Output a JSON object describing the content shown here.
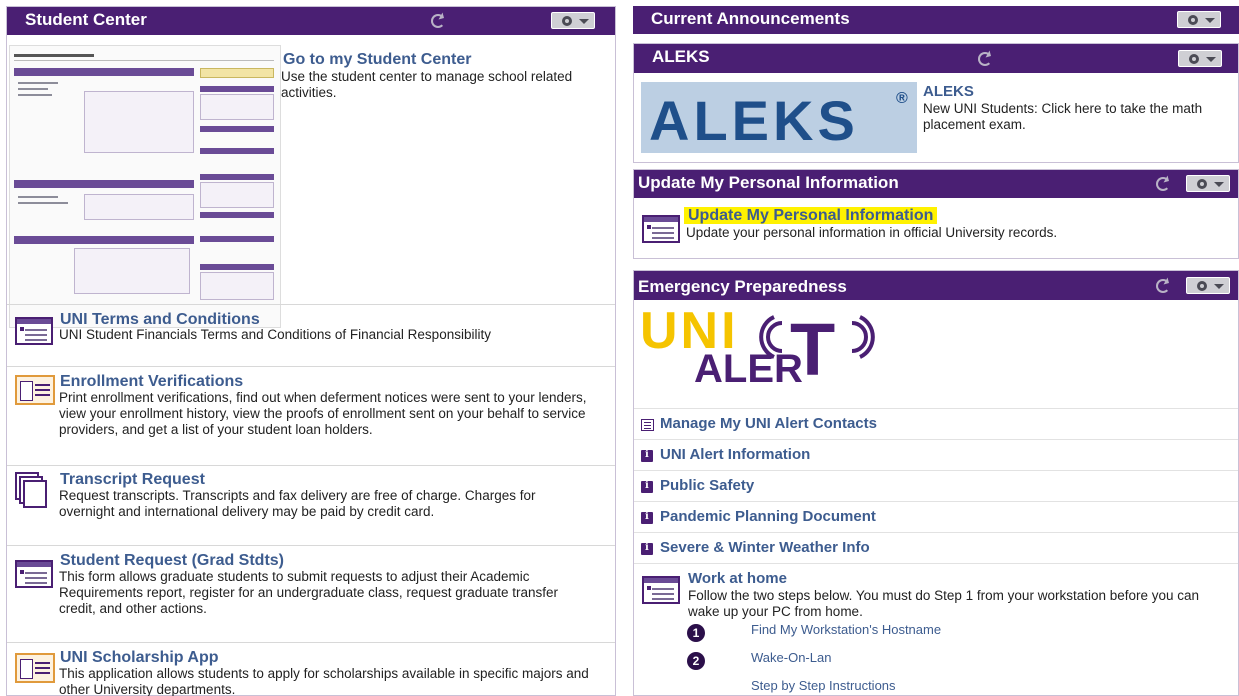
{
  "student_center": {
    "title": "Student Center",
    "go": {
      "title": "Go to my Student Center",
      "desc": "Use the student center to manage school related activities."
    },
    "items": [
      {
        "title": "UNI Terms and Conditions",
        "desc": "UNI Student Financials Terms and Conditions of Financial Responsibility"
      },
      {
        "title": "Enrollment Verifications",
        "desc": "Print enrollment verifications, find out when deferment notices were sent to your lenders, view your enrollment history, view the proofs of enrollment sent on your behalf to service providers, and get a list of your student loan holders."
      },
      {
        "title": "Transcript Request",
        "desc": "Request transcripts. Transcripts and fax delivery are free of charge. Charges for overnight and international delivery may be paid by credit card."
      },
      {
        "title": "Student Request (Grad Stdts)",
        "desc": "This form allows graduate students to submit requests to adjust their Academic Requirements report, register for an undergraduate class, request graduate transfer credit, and other actions."
      },
      {
        "title": "UNI Scholarship App",
        "desc": "This application allows students to apply for scholarships available in specific majors and other University departments."
      }
    ]
  },
  "announcements": {
    "title": "Current Announcements"
  },
  "aleks": {
    "title": "ALEKS",
    "logo_text": "ALEKS",
    "logo_mark": "®",
    "link": "ALEKS",
    "desc": "New UNI Students: Click here to take the math placement exam."
  },
  "personal_info": {
    "title": "Update My Personal Information",
    "link": "Update My Personal Information",
    "desc": "Update your personal information in official University records."
  },
  "emergency": {
    "title": "Emergency Preparedness",
    "logo_top": "UNI",
    "logo_bottom": "ALER",
    "logo_t": "T",
    "links": [
      "Manage My UNI Alert Contacts",
      "UNI Alert Information",
      "Public Safety",
      "Pandemic Planning Document",
      "Severe & Winter Weather Info"
    ],
    "work_home": {
      "title": "Work at home",
      "desc": "Follow the two steps below. You must do Step 1 from your workstation before you can wake up your PC from home.",
      "steps": [
        {
          "num": "1",
          "label": "Find My Workstation's Hostname"
        },
        {
          "num": "2",
          "label": "Wake-On-Lan"
        }
      ],
      "instructions": "Step by Step Instructions"
    }
  },
  "colors": {
    "bar": "#4a1f73",
    "link": "#3d5c8f",
    "highlight": "#fff200",
    "aleks_blue": "#1f4f8a",
    "alert_yellow": "#f5c400"
  }
}
